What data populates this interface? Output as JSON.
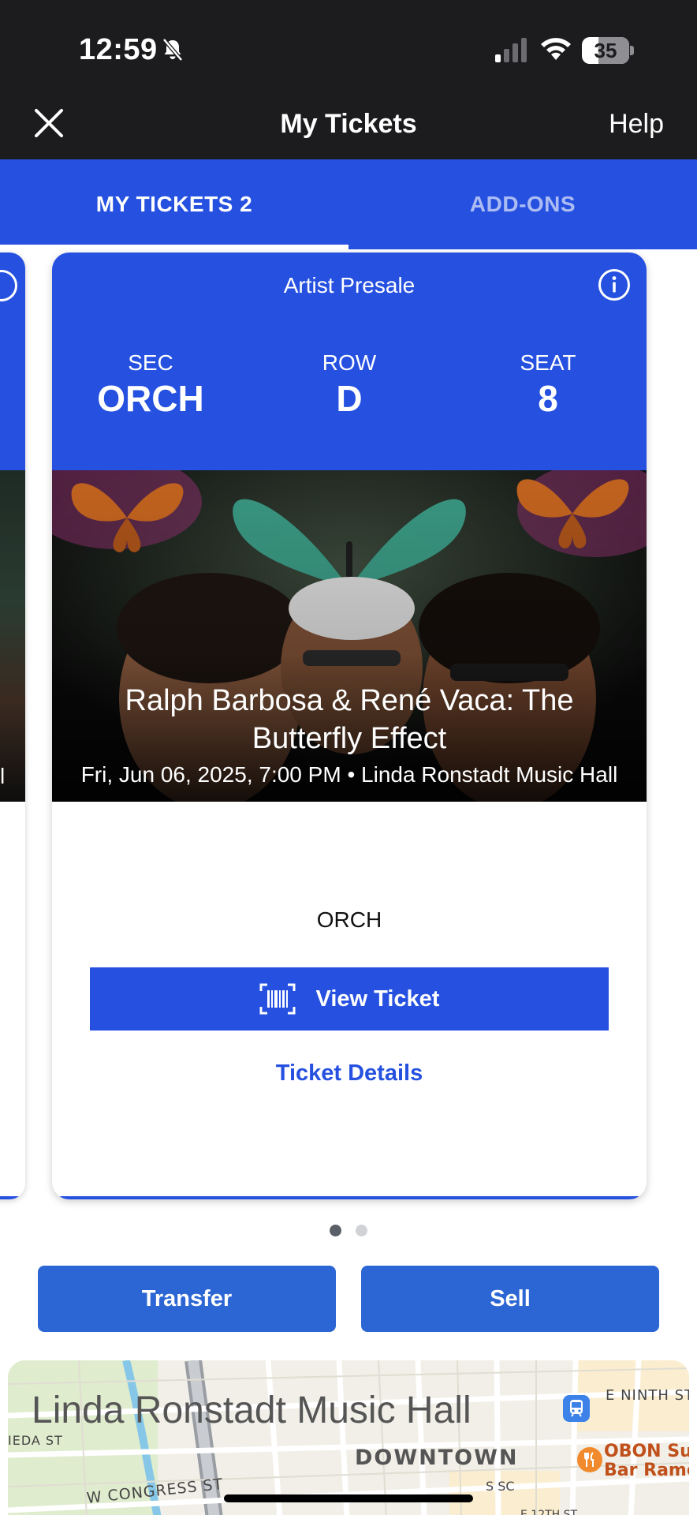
{
  "status_bar": {
    "time": "12:59",
    "battery": "35",
    "battery_level_percent": 35,
    "icons": [
      "bell-slash-icon",
      "cellular-signal-icon",
      "wifi-icon",
      "battery-icon"
    ]
  },
  "nav": {
    "title": "My Tickets",
    "help_label": "Help",
    "close_icon": "close-icon"
  },
  "tabs": [
    {
      "label": "MY TICKETS 2",
      "active": true
    },
    {
      "label": "ADD-ONS",
      "active": false
    }
  ],
  "ticket": {
    "presale_label": "Artist Presale",
    "sec_label": "SEC",
    "sec_value": "ORCH",
    "row_label": "ROW",
    "row_value": "D",
    "seat_label": "SEAT",
    "seat_value": "8",
    "event_title": "Ralph Barbosa & René Vaca: The Butterfly Effect",
    "event_meta": "Fri, Jun 06, 2025, 7:00 PM • Linda Ronstadt Music Hall",
    "section_name": "ORCH",
    "view_ticket_label": "View Ticket",
    "ticket_details_label": "Ticket Details"
  },
  "ghost_card": {
    "meta_fragment": "l"
  },
  "pager": {
    "total": 2,
    "current": 1
  },
  "actions": {
    "transfer_label": "Transfer",
    "sell_label": "Sell"
  },
  "map": {
    "venue_name": "Linda Ronstadt Music Hall",
    "labels": {
      "downtown": "DOWNTOWN",
      "ninth": "E NINTH ST",
      "meda": "IEDA ST",
      "congress": "W CONGRESS ST",
      "restaurant_line1": "OBON Sus",
      "restaurant_line2": "Bar Ramer",
      "s_sc": "S SC",
      "twelfth": "E 12TH ST"
    }
  },
  "colors": {
    "brand_blue": "#2550e0",
    "action_blue": "#2c66d4",
    "status_bg": "#1c1c1e"
  }
}
